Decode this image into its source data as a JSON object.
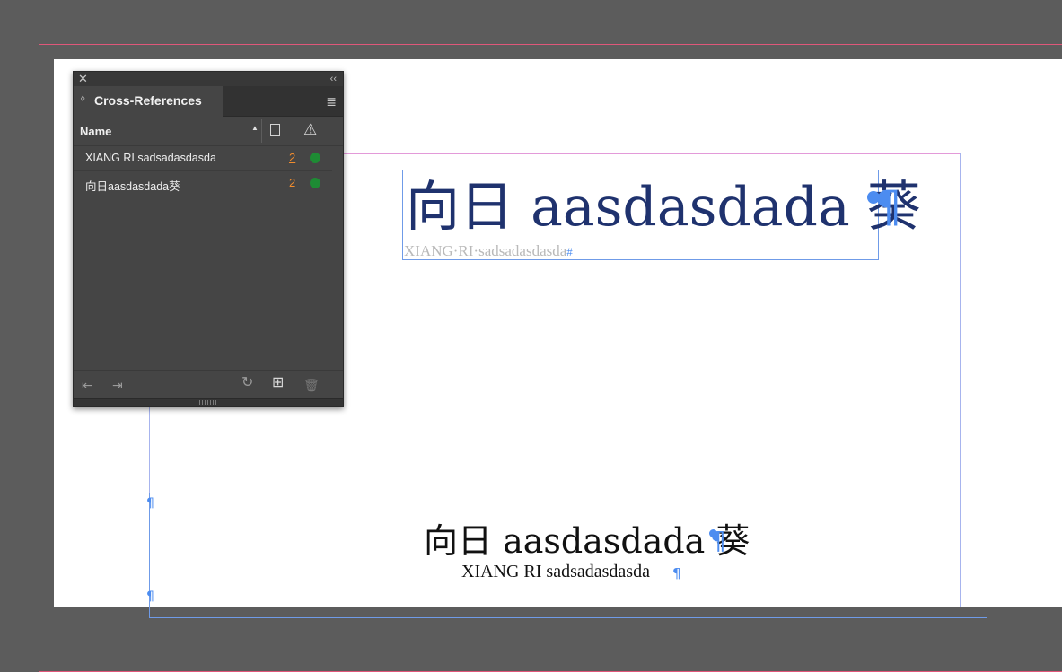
{
  "document": {
    "heading_large": "向日 aasdasdada 葵",
    "subheading_large": "XIANG·RI·sadsadasdasda",
    "heading_small": "向日 aasdasdada 葵",
    "subheading_small": "XIANG RI sadsadasdasda",
    "hidden_char_hash": "#",
    "para_mark": "¶"
  },
  "panel": {
    "close_glyph": "✕",
    "collapse_glyph": "‹‹",
    "tab_grip_glyph": "◊",
    "title": "Cross-References",
    "menu_glyph": "≣",
    "column_name": "Name",
    "sort_glyph": "▲",
    "warning_glyph": "⚠",
    "rows": [
      {
        "name": "XIANG RI sadsadasdasda",
        "page": "2",
        "status": "ok"
      },
      {
        "name": "向日aasdasdada葵",
        "page": "2",
        "status": "ok"
      }
    ],
    "bottom_icons": {
      "goto_source": "⇤",
      "goto_destination": "⇥",
      "update": "↻",
      "new": "⊞",
      "delete": "🗑"
    }
  },
  "colors": {
    "heading_blue": "#1f326e",
    "frame_blue": "#6f9be8",
    "status_green": "#1e8b34",
    "page_link_orange": "#f08c2e"
  }
}
